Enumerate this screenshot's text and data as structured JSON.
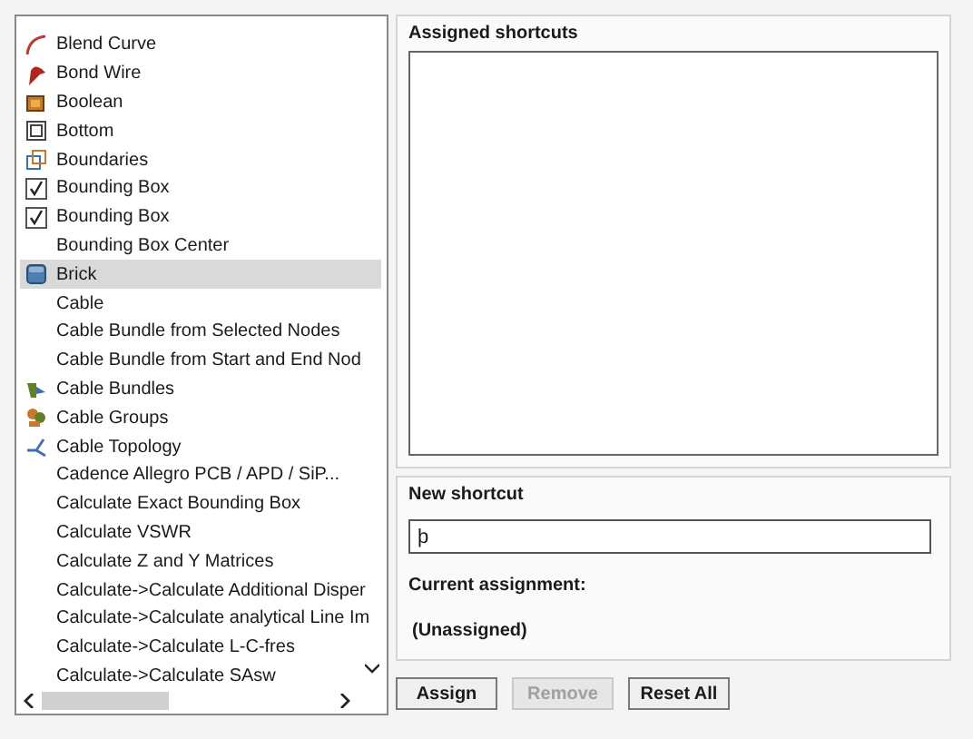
{
  "commands": [
    {
      "label": "Blend Curve",
      "kind": "curve",
      "selected": false
    },
    {
      "label": "Bond Wire",
      "kind": "wire",
      "selected": false
    },
    {
      "label": "Boolean",
      "kind": "boolean",
      "selected": false
    },
    {
      "label": "Bottom",
      "kind": "bottom",
      "selected": false
    },
    {
      "label": "Boundaries",
      "kind": "boundaries",
      "selected": false
    },
    {
      "label": "Bounding Box",
      "kind": "check",
      "selected": false
    },
    {
      "label": "Bounding Box",
      "kind": "check",
      "selected": false
    },
    {
      "label": "Bounding Box Center",
      "selected": false
    },
    {
      "label": "Brick",
      "kind": "brick",
      "selected": true
    },
    {
      "label": "Cable",
      "selected": false
    },
    {
      "label": "Cable Bundle from Selected Nodes",
      "selected": false
    },
    {
      "label": "Cable Bundle from Start and End Nod",
      "selected": false
    },
    {
      "label": "Cable Bundles",
      "kind": "bundles",
      "selected": false
    },
    {
      "label": "Cable Groups",
      "kind": "groups",
      "selected": false
    },
    {
      "label": "Cable Topology",
      "kind": "topology",
      "selected": false
    },
    {
      "label": "Cadence Allegro PCB / APD / SiP...",
      "selected": false
    },
    {
      "label": "Calculate Exact Bounding Box",
      "selected": false
    },
    {
      "label": "Calculate VSWR",
      "selected": false
    },
    {
      "label": "Calculate Z and Y Matrices",
      "selected": false
    },
    {
      "label": "Calculate->Calculate Additional Disper",
      "selected": false
    },
    {
      "label": "Calculate->Calculate analytical Line Im",
      "selected": false
    },
    {
      "label": "Calculate->Calculate L-C-fres",
      "selected": false
    },
    {
      "label": "Calculate->Calculate SAsw",
      "selected": false
    }
  ],
  "assigned": {
    "title": "Assigned shortcuts"
  },
  "new_shortcut": {
    "title": "New shortcut",
    "value": "þ",
    "current_label": "Current assignment:",
    "current_value": "(Unassigned)"
  },
  "buttons": [
    {
      "label": "Assign",
      "disabled": false
    },
    {
      "label": "Remove",
      "disabled": true
    },
    {
      "label": "Reset All",
      "disabled": false
    }
  ]
}
